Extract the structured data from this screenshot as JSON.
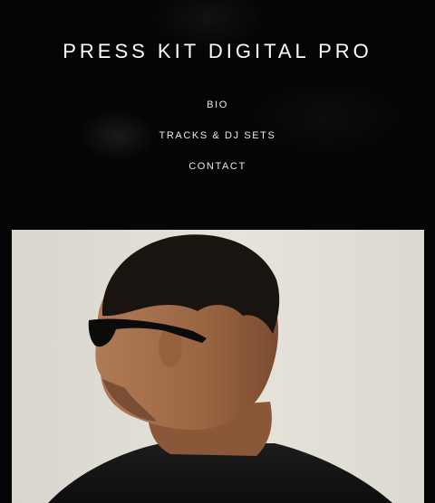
{
  "header": {
    "title": "PRESS KIT DIGITAL PRO"
  },
  "nav": {
    "items": [
      {
        "label": "BIO"
      },
      {
        "label": "TRACKS & DJ SETS"
      },
      {
        "label": "CONTACT"
      }
    ]
  },
  "colors": {
    "background": "#000000",
    "text": "#ffffff",
    "photo_background": "#e3e0d8"
  }
}
